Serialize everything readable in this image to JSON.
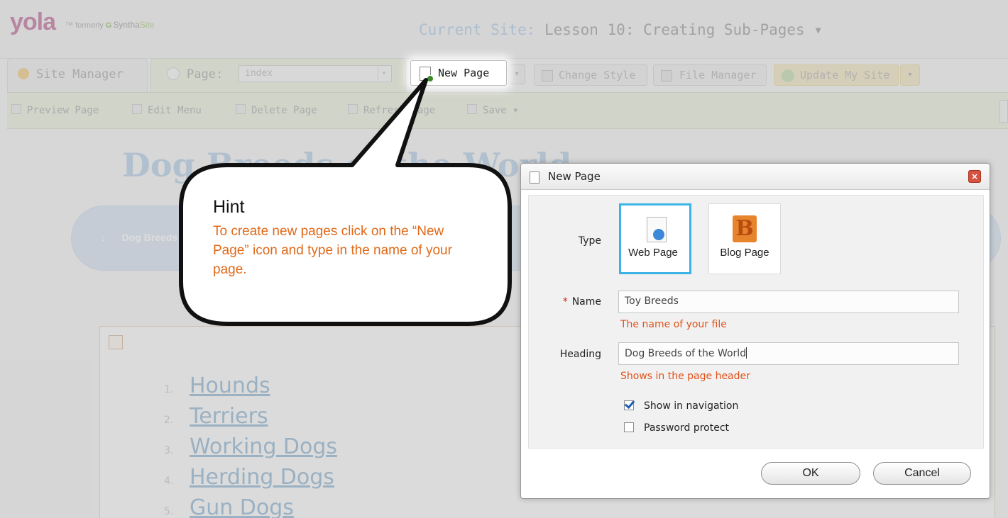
{
  "brand": {
    "logo": "yola",
    "tm": "™",
    "formerly": "formerly",
    "synth": "Syntha",
    "site": "Site"
  },
  "current_site": {
    "label": "Current Site:",
    "name": "Lesson 10: Creating Sub-Pages",
    "caret": "▾"
  },
  "tabs": {
    "site_manager": "Site Manager",
    "page_label": "Page:",
    "page_value": "index"
  },
  "toolbar": {
    "new_page": "New Page",
    "change_style": "Change Style",
    "file_manager": "File Manager",
    "update_site": "Update My Site"
  },
  "actions": {
    "preview": "Preview Page",
    "edit_menu": "Edit Menu",
    "delete": "Delete Page",
    "refresh": "Refresh Page",
    "save": "Save"
  },
  "page": {
    "heading": "Dog Breeds of the World",
    "nav_item": "Dog Breeds"
  },
  "list": [
    {
      "num": "1.",
      "text": "Hounds"
    },
    {
      "num": "2.",
      "text": "Terriers"
    },
    {
      "num": "3.",
      "text": "Working Dogs"
    },
    {
      "num": "4.",
      "text": "Herding Dogs"
    },
    {
      "num": "5.",
      "text": "Gun Dogs"
    }
  ],
  "hint": {
    "title": "Hint",
    "text": "To create new pages click on the “New Page” icon and type in the name of your page."
  },
  "dialog": {
    "title": "New Page",
    "type_label": "Type",
    "web_page": "Web Page",
    "blog_page": "Blog Page",
    "blog_letter": "B",
    "name_label": "Name",
    "name_value": "Toy Breeds",
    "name_hint": "The name of your file",
    "heading_label": "Heading",
    "heading_value": "Dog Breeds of the World",
    "heading_hint": "Shows in the page header",
    "show_nav": "Show in navigation",
    "show_nav_checked": true,
    "password": "Password protect",
    "password_checked": false,
    "ok": "OK",
    "cancel": "Cancel"
  },
  "colors": {
    "accent": "#3cb3e6",
    "hint_orange": "#e06a1a",
    "field_hint": "#e0521a"
  }
}
